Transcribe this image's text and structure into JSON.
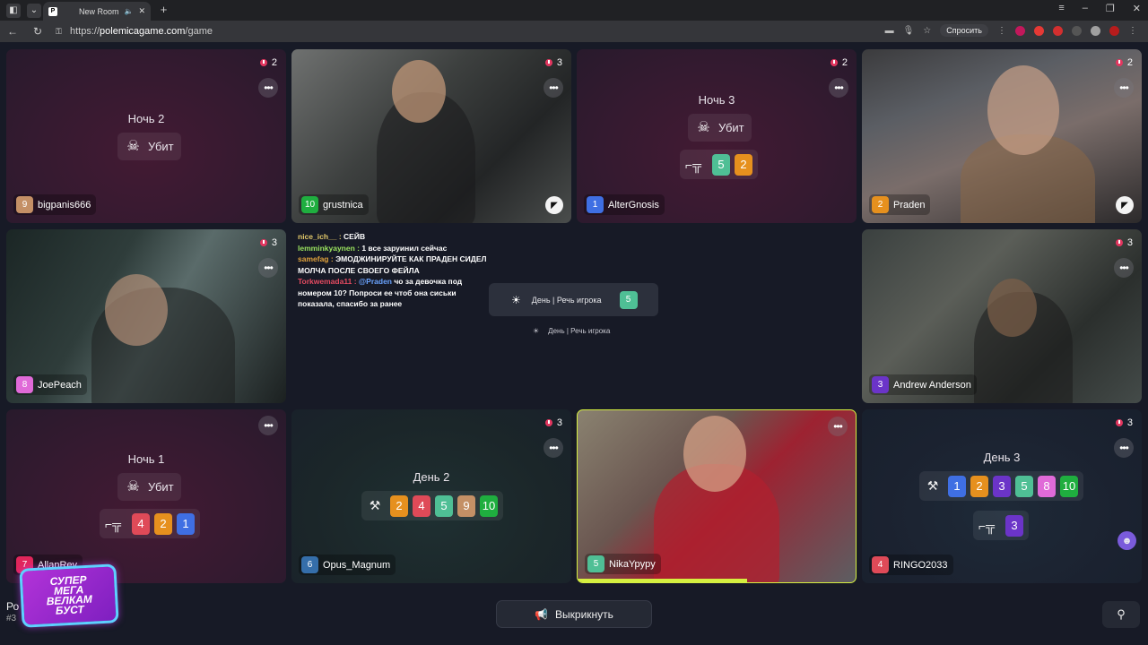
{
  "browser": {
    "tab_title": "New Room",
    "tab_favicon": "P",
    "url_prefix": "https://",
    "url_host": "polemicagame.com",
    "url_path": "/game",
    "ask_label": "Спросить"
  },
  "colors": {
    "red_tile": "#351a30",
    "dark_tile": "#1b2629",
    "speaking_border": "#d5ef40",
    "badge": "#e2365f"
  },
  "player_colors": {
    "1": "#3f6fe3",
    "2": "#e6901e",
    "3": "#6b34c8",
    "4": "#df4a58",
    "5": "#4fbf95",
    "6": "#356eaa",
    "7": "#e1265b",
    "8": "#e06ad8",
    "9": "#c49066",
    "10": "#1fae3f"
  },
  "players": [
    {
      "num": "9",
      "name": "bigpanis666",
      "fouls": "2",
      "phase": "Ночь 2",
      "status": "Убит"
    },
    {
      "num": "10",
      "name": "grustnica",
      "fouls": "3"
    },
    {
      "num": "1",
      "name": "AlterGnosis",
      "fouls": "2",
      "phase": "Ночь 3",
      "status": "Убит",
      "shots": [
        "5",
        "2"
      ]
    },
    {
      "num": "2",
      "name": "Praden",
      "fouls": "2"
    },
    {
      "num": "8",
      "name": "JoePeach",
      "fouls": "3"
    },
    {
      "num": "3",
      "name": "Andrew Anderson",
      "fouls": "3"
    },
    {
      "num": "7",
      "name": "AllanRey",
      "phase": "Ночь 1",
      "status": "Убит",
      "shots": [
        "4",
        "2",
        "1"
      ]
    },
    {
      "num": "6",
      "name": "Opus_Magnum",
      "fouls": "3",
      "phase": "День 2",
      "votes": [
        "2",
        "4",
        "5",
        "9",
        "10"
      ]
    },
    {
      "num": "5",
      "name": "NikaYpypy"
    },
    {
      "num": "4",
      "name": "RINGO2033",
      "fouls": "3",
      "phase": "День 3",
      "votes": [
        "1",
        "2",
        "3",
        "5",
        "8",
        "10"
      ],
      "shots": [
        "3"
      ]
    }
  ],
  "chat": [
    {
      "user": "nice_ich__",
      "text": "СЕЙВ"
    },
    {
      "user": "lemminkyaynen",
      "text": "1 все заруинил сейчас"
    },
    {
      "user": "samefag",
      "text": "ЭМОДЖИНИРУЙТЕ КАК ПРАДЕН СИДЕЛ МОЛЧА ПОСЛЕ СВОЕГО ФЕЙЛА"
    },
    {
      "user": "Torkwemada11",
      "mention": "@Praden",
      "text": "чо за девочка под номером 10? Попроси ее чтоб она сиськи показала, спасибо за ранее"
    }
  ],
  "center": {
    "day_label": "День | Речь игрока",
    "speaker_num": "5",
    "day_small": "День | Речь игрока"
  },
  "speaking_progress": 0.61,
  "bottom": {
    "kick_label": "Выкрикнуть",
    "room_short": "Ро",
    "room_num": "#3",
    "sticker": [
      "Супер",
      "Мега",
      "Велкам",
      "Буст"
    ]
  },
  "icons": {
    "skull": "skull-icon",
    "gun": "gun-icon",
    "gavel": "gavel-icon",
    "sun": "sun-icon",
    "megaphone": "megaphone-icon",
    "more": "more-icon",
    "foul": "foul-icon",
    "camera": "camera-icon"
  }
}
